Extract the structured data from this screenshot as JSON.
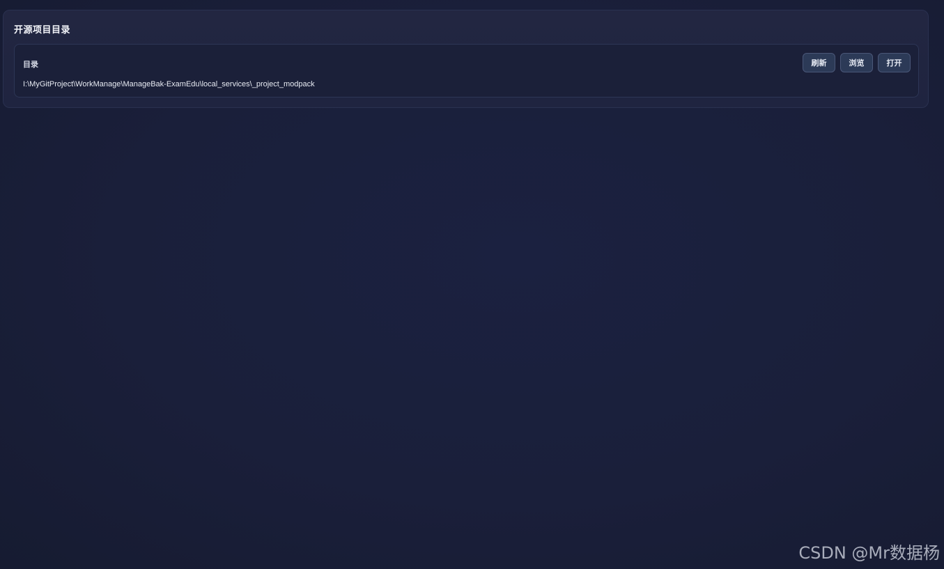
{
  "panel": {
    "title": "开源项目目录"
  },
  "directory": {
    "label": "目录",
    "path": "I:\\MyGitProject\\WorkManage\\ManageBak-ExamEdu\\local_services\\_project_modpack",
    "buttons": {
      "refresh": "刷新",
      "browse": "浏览",
      "open": "打开"
    }
  },
  "watermark": "CSDN @Mr数据杨"
}
